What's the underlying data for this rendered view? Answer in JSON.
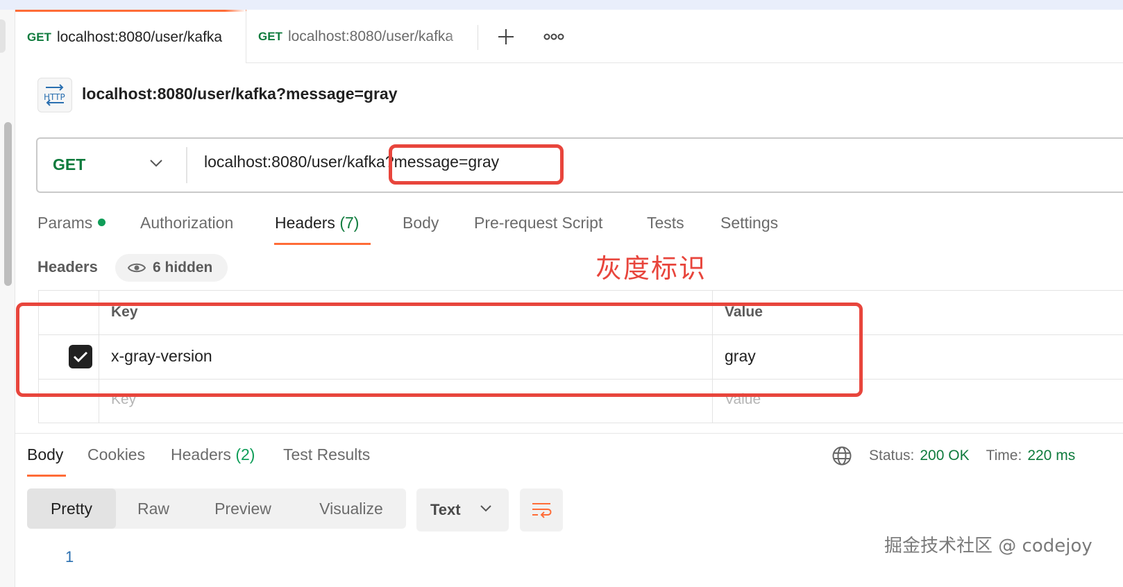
{
  "tabs": [
    {
      "method": "GET",
      "url": "localhost:8080/user/kafka"
    },
    {
      "method": "GET",
      "url": "localhost:8080/user/kafka"
    }
  ],
  "tab_actions": {
    "add_icon": "plus-icon",
    "more_icon": "more-icon"
  },
  "request": {
    "badge": "HTTP",
    "title": "localhost:8080/user/kafka?message=gray",
    "method": "GET",
    "url": "localhost:8080/user/kafka?message=gray"
  },
  "request_tabs": [
    {
      "label": "Params",
      "count": "",
      "active": false
    },
    {
      "label": "Authorization",
      "count": "",
      "active": false
    },
    {
      "label": "Headers",
      "count": "(7)",
      "active": true
    },
    {
      "label": "Body",
      "count": "",
      "active": false
    },
    {
      "label": "Pre-request Script",
      "count": "",
      "active": false
    },
    {
      "label": "Tests",
      "count": "",
      "active": false
    },
    {
      "label": "Settings",
      "count": "",
      "active": false
    }
  ],
  "headers_section": {
    "label": "Headers",
    "hidden_label": "6 hidden",
    "columns": {
      "key": "Key",
      "value": "Value"
    },
    "rows": [
      {
        "checked": true,
        "key": "x-gray-version",
        "value": "gray"
      }
    ],
    "placeholder": {
      "key": "Key",
      "value": "Value"
    }
  },
  "annotation": "灰度标识",
  "response": {
    "tabs": [
      {
        "label": "Body",
        "count": "",
        "active": true
      },
      {
        "label": "Cookies",
        "count": "",
        "active": false
      },
      {
        "label": "Headers",
        "count": "(2)",
        "active": false
      },
      {
        "label": "Test Results",
        "count": "",
        "active": false
      }
    ],
    "status_label": "Status:",
    "status_value": "200 OK",
    "time_label": "Time:",
    "time_value": "220 ms",
    "formats": [
      "Pretty",
      "Raw",
      "Preview",
      "Visualize"
    ],
    "active_format": "Pretty",
    "text_select": "Text",
    "line_number": "1"
  },
  "watermark": "掘金技术社区 @ codejoy",
  "colors": {
    "accent": "#ff6c37",
    "method_green": "#0f7b3d",
    "annotation_red": "#e8453c"
  }
}
